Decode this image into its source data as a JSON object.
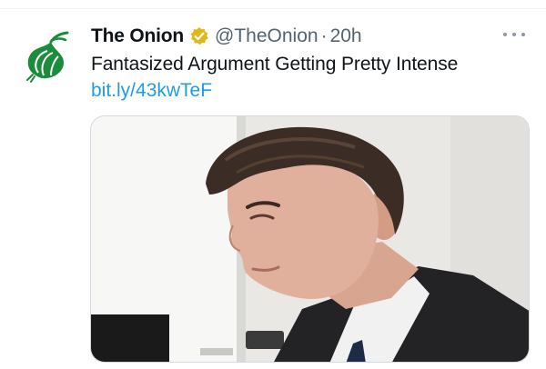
{
  "tweet": {
    "display_name": "The Onion",
    "handle": "@TheOnion",
    "separator": "·",
    "time": "20h",
    "text": "Fantasized Argument Getting Pretty Intense",
    "link": "bit.ly/43kwTeF"
  },
  "icons": {
    "avatar": "onion-logo-icon",
    "verified": "verified-badge-icon",
    "more": "more-options-icon"
  },
  "colors": {
    "brand_green": "#1a8c3c",
    "verified_gold": "#e2b719",
    "link_blue": "#1d9bf0",
    "secondary_text": "#536471"
  }
}
